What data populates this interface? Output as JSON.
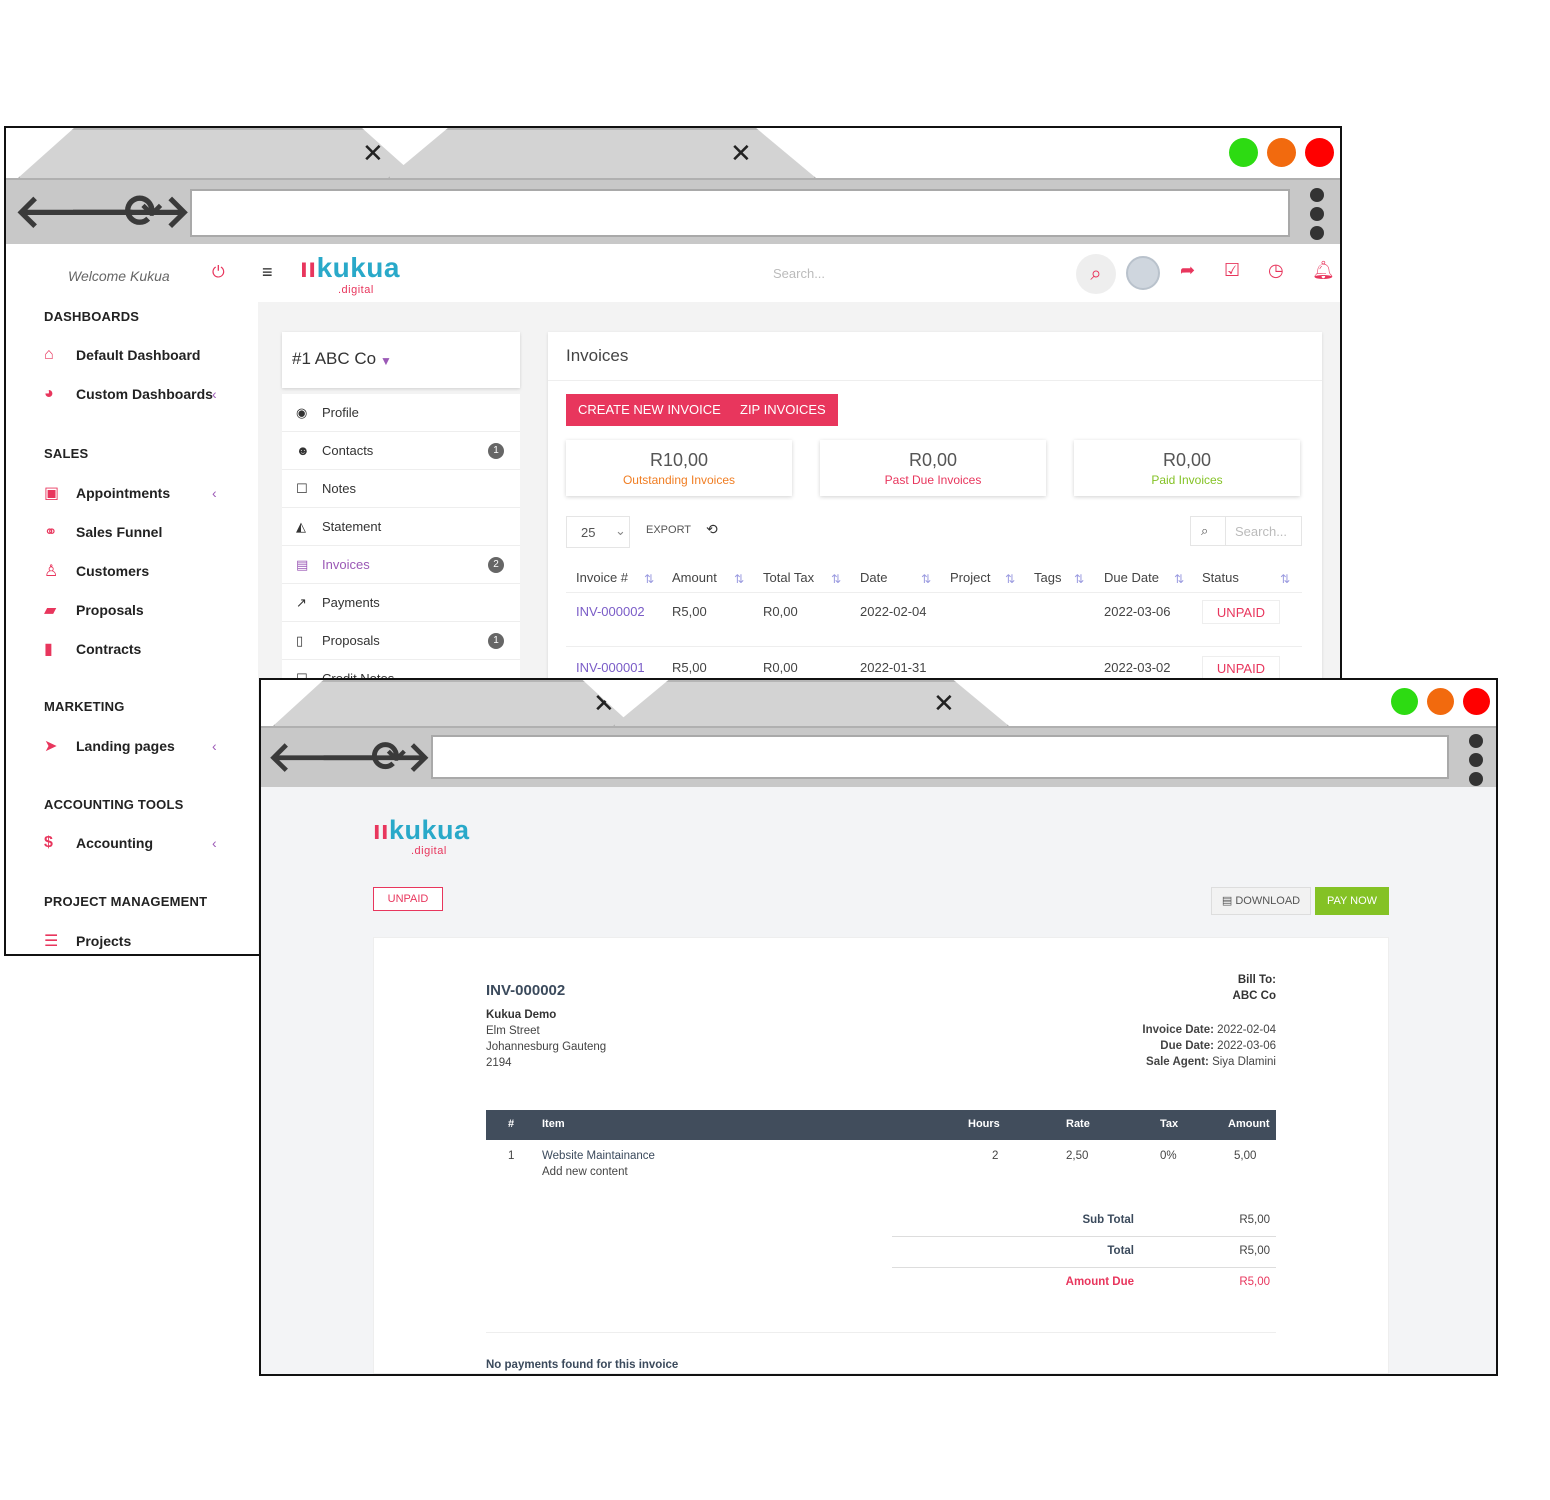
{
  "colors": {
    "accent": "#e8365d",
    "purple": "#7a5cc7",
    "orange": "#f07d22",
    "green": "#84c225",
    "light_green": "#2ddb12",
    "light_orange": "#f26a0e",
    "light_red": "#ff0000"
  },
  "browser": {
    "tab_close": "✕",
    "back": "back-arrow-icon",
    "forward": "forward-arrow-icon",
    "reload": "reload-icon",
    "menu": "kebab-menu-icon"
  },
  "crm": {
    "welcome": "Welcome Kukua",
    "logo": {
      "name": "kukua",
      "sub": ".digital"
    },
    "search_placeholder": "Search...",
    "sidebar": {
      "dashboards": "DASHBOARDS",
      "default_dashboard": "Default Dashboard",
      "custom_dashboards": "Custom Dashboards",
      "sales": "SALES",
      "appointments": "Appointments",
      "sales_funnel": "Sales Funnel",
      "customers": "Customers",
      "proposals": "Proposals",
      "contracts": "Contracts",
      "marketing": "MARKETING",
      "landing_pages": "Landing pages",
      "accounting_tools": "ACCOUNTING TOOLS",
      "accounting": "Accounting",
      "project_management": "PROJECT MANAGEMENT",
      "projects": "Projects"
    },
    "customer": {
      "name": "#1 ABC Co"
    },
    "customer_menu": {
      "profile": "Profile",
      "contacts": "Contacts",
      "contacts_count": "1",
      "notes": "Notes",
      "statement": "Statement",
      "invoices": "Invoices",
      "invoices_count": "2",
      "payments": "Payments",
      "proposals": "Proposals",
      "proposals_count": "1",
      "credit_notes": "Credit Notes"
    },
    "invoices": {
      "title": "Invoices",
      "create_btn": "CREATE NEW INVOICE",
      "zip_btn": "ZIP INVOICES",
      "outstanding_value": "R10,00",
      "outstanding_label": "Outstanding Invoices",
      "pastdue_value": "R0,00",
      "pastdue_label": "Past Due Invoices",
      "paid_value": "R0,00",
      "paid_label": "Paid Invoices",
      "page_length": "25",
      "export": "EXPORT",
      "search_placeholder": "Search...",
      "columns": {
        "number": "Invoice #",
        "amount": "Amount",
        "tax": "Total Tax",
        "date": "Date",
        "project": "Project",
        "tags": "Tags",
        "due": "Due Date",
        "status": "Status"
      },
      "rows": [
        {
          "number": "INV-000002",
          "amount": "R5,00",
          "tax": "R0,00",
          "date": "2022-02-04",
          "due": "2022-03-06",
          "status": "UNPAID"
        },
        {
          "number": "INV-000001",
          "amount": "R5,00",
          "tax": "R0,00",
          "date": "2022-01-31",
          "due": "2022-03-02",
          "status": "UNPAID"
        }
      ]
    }
  },
  "invoice_view": {
    "status": "UNPAID",
    "download": "DOWNLOAD",
    "pay_now": "PAY NOW",
    "number": "INV-000002",
    "company": "Kukua Demo",
    "address1": "Elm Street",
    "address2": "Johannesburg Gauteng",
    "postcode": "2194",
    "bill_to_label": "Bill To:",
    "bill_to": "ABC Co",
    "invoice_date_label": "Invoice Date:",
    "invoice_date": "2022-02-04",
    "due_date_label": "Due Date:",
    "due_date": "2022-03-06",
    "agent_label": "Sale Agent:",
    "agent": "Siya Dlamini",
    "columns": {
      "num": "#",
      "item": "Item",
      "hours": "Hours",
      "rate": "Rate",
      "tax": "Tax",
      "amount": "Amount"
    },
    "items": [
      {
        "num": "1",
        "name": "Website Maintainance",
        "desc": "Add new content",
        "hours": "2",
        "rate": "2,50",
        "tax": "0%",
        "amount": "5,00"
      }
    ],
    "sub_total_label": "Sub Total",
    "sub_total": "R5,00",
    "total_label": "Total",
    "total": "R5,00",
    "amount_due_label": "Amount Due",
    "amount_due": "R5,00",
    "no_payments": "No payments found for this invoice"
  }
}
